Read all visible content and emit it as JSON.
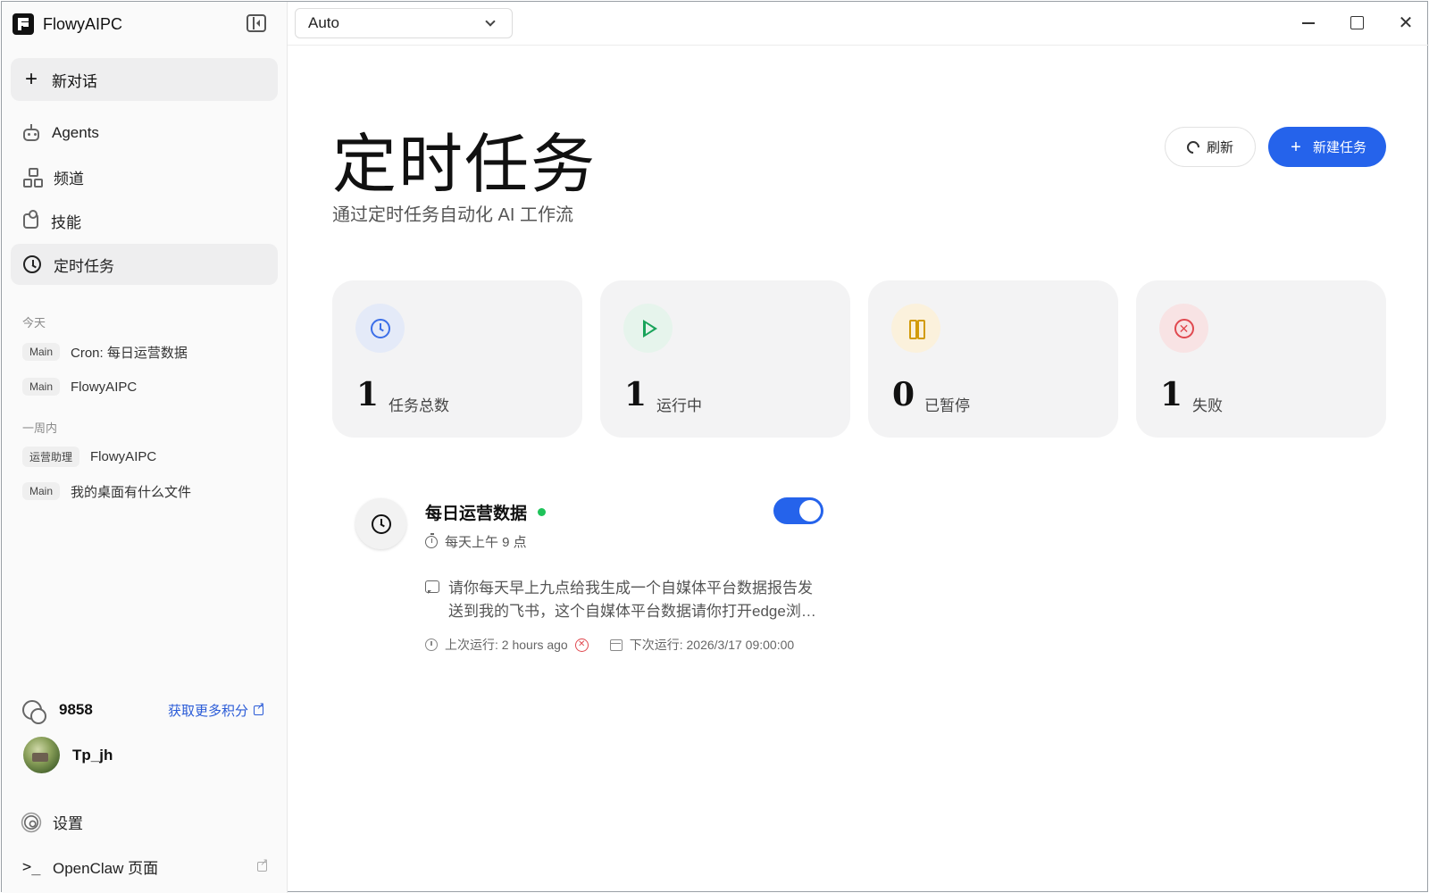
{
  "app": {
    "name": "FlowyAIPC"
  },
  "sidebar": {
    "new_chat_label": "新对话",
    "nav": [
      {
        "label": "Agents",
        "icon": "robot-icon"
      },
      {
        "label": "频道",
        "icon": "network-icon"
      },
      {
        "label": "技能",
        "icon": "puzzle-icon"
      },
      {
        "label": "定时任务",
        "icon": "clock-icon",
        "active": true
      }
    ],
    "history": {
      "today_label": "今天",
      "today": [
        {
          "tag": "Main",
          "title": "Cron: 每日运营数据"
        },
        {
          "tag": "Main",
          "title": "FlowyAIPC"
        }
      ],
      "week_label": "一周内",
      "week": [
        {
          "tag": "运营助理",
          "title": "FlowyAIPC"
        },
        {
          "tag": "Main",
          "title": "我的桌面有什么文件"
        }
      ]
    },
    "credits": {
      "value": "9858",
      "link_label": "获取更多积分"
    },
    "user": {
      "name": "Tp_jh"
    },
    "settings_label": "设置",
    "openclaw": {
      "prompt": ">_",
      "label": "OpenClaw 页面"
    }
  },
  "topbar": {
    "model_select": "Auto",
    "window_close": "✕"
  },
  "main": {
    "title": "定时任务",
    "subtitle": "通过定时任务自动化 AI 工作流",
    "refresh_label": "刷新",
    "new_task_label": "新建任务",
    "stats": [
      {
        "value": "1",
        "label": "任务总数",
        "color": "#3b6ee8",
        "bg": "#e4eaf8"
      },
      {
        "value": "1",
        "label": "运行中",
        "color": "#19a35a",
        "bg": "#e6f4ec"
      },
      {
        "value": "0",
        "label": "已暂停",
        "color": "#d29b09",
        "bg": "#fbf1dc"
      },
      {
        "value": "1",
        "label": "失败",
        "color": "#e0484f",
        "bg": "#f8e3e4"
      }
    ],
    "task": {
      "title": "每日运营数据",
      "enabled": true,
      "schedule": "每天上午 9 点",
      "description": "请你每天早上九点给我生成一个自媒体平台数据报告发送到我的飞书，这个自媒体平台数据请你打开edge浏览器",
      "last_run": "上次运行: 2 hours ago",
      "last_status": "failed",
      "next_run": "下次运行: 2026/3/17 09:00:00"
    }
  }
}
